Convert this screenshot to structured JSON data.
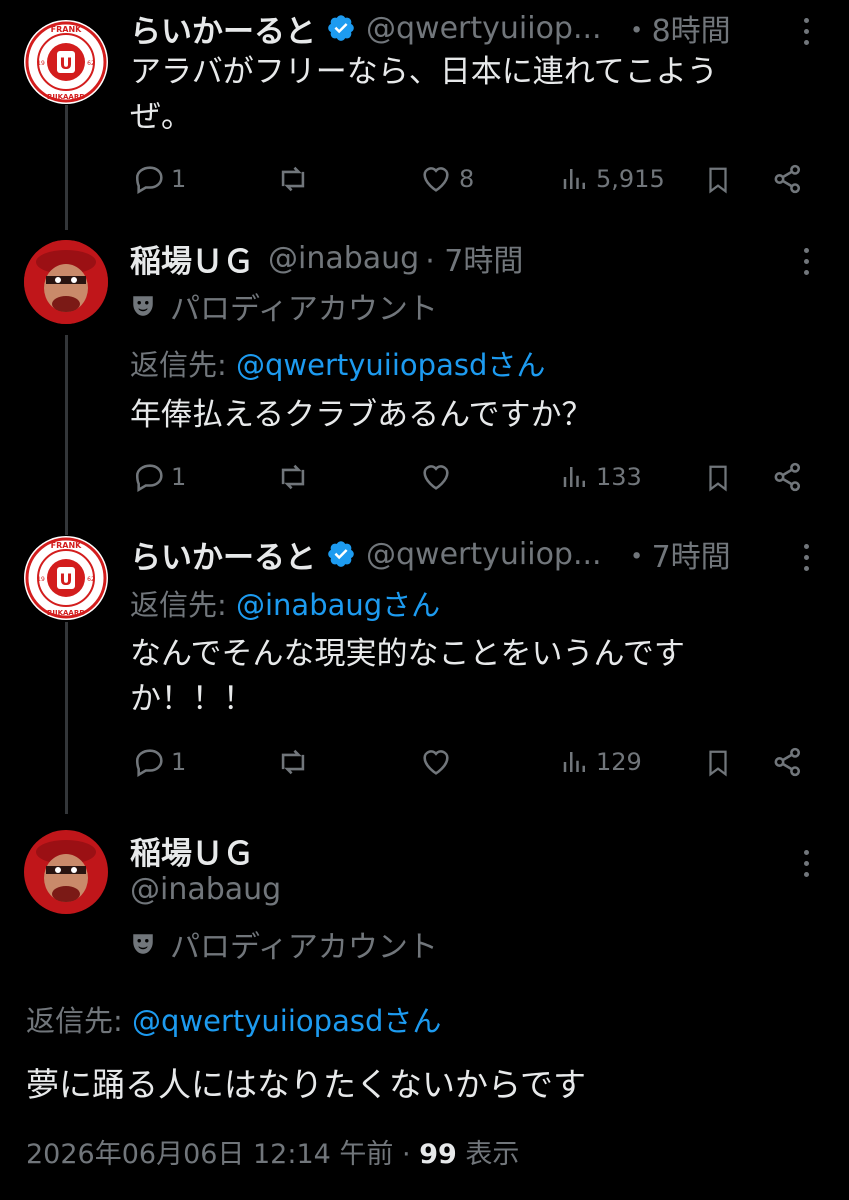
{
  "tweets": [
    {
      "name": "らいかーると",
      "handle": "@qwertyuiiop...",
      "time": "・8時間",
      "text_line1": "アラバがフリーなら、日本に連れてこよう",
      "text_line2": "ぜ。",
      "replies": "1",
      "likes": "8",
      "views": "5,915"
    },
    {
      "name": "稲場ＵＧ",
      "handle": "@inabaug",
      "time": "· 7時間",
      "parody_label": "パロディアカウント",
      "reply_prefix": "返信先:",
      "reply_to": "@qwertyuiiopasdさん",
      "text": "年俸払えるクラブあるんですか？",
      "replies": "1",
      "likes": "",
      "views": "133"
    },
    {
      "name": "らいかーると",
      "handle": "@qwertyuiiop...",
      "time": "・7時間",
      "reply_prefix": "返信先:",
      "reply_to": "@inabaugさん",
      "text_line1": "なんでそんな現実的なことをいうんです",
      "text_line2": "か！！！",
      "replies": "1",
      "likes": "",
      "views": "129"
    }
  ],
  "main_tweet": {
    "name": "稲場ＵＧ",
    "handle": "@inabaug",
    "parody_label": "パロディアカウント",
    "reply_prefix": "返信先:",
    "reply_to": "@qwertyuiiopasdさん",
    "text": "夢に踊る人にはなりたくないからです",
    "timestamp": "2026年06月06日 12:14 午前",
    "sep": "·",
    "view_count": "99",
    "view_label": "表示"
  },
  "logo": {
    "top": "FRANK",
    "bottom": "RIJKAARD",
    "left_num": "19",
    "right_num": "62",
    "center": "U"
  },
  "colors": {
    "background": "#000000",
    "text": "#e7e9ea",
    "secondary": "#71767b",
    "link": "#1d9bf0",
    "verified": "#1d9bf0"
  }
}
